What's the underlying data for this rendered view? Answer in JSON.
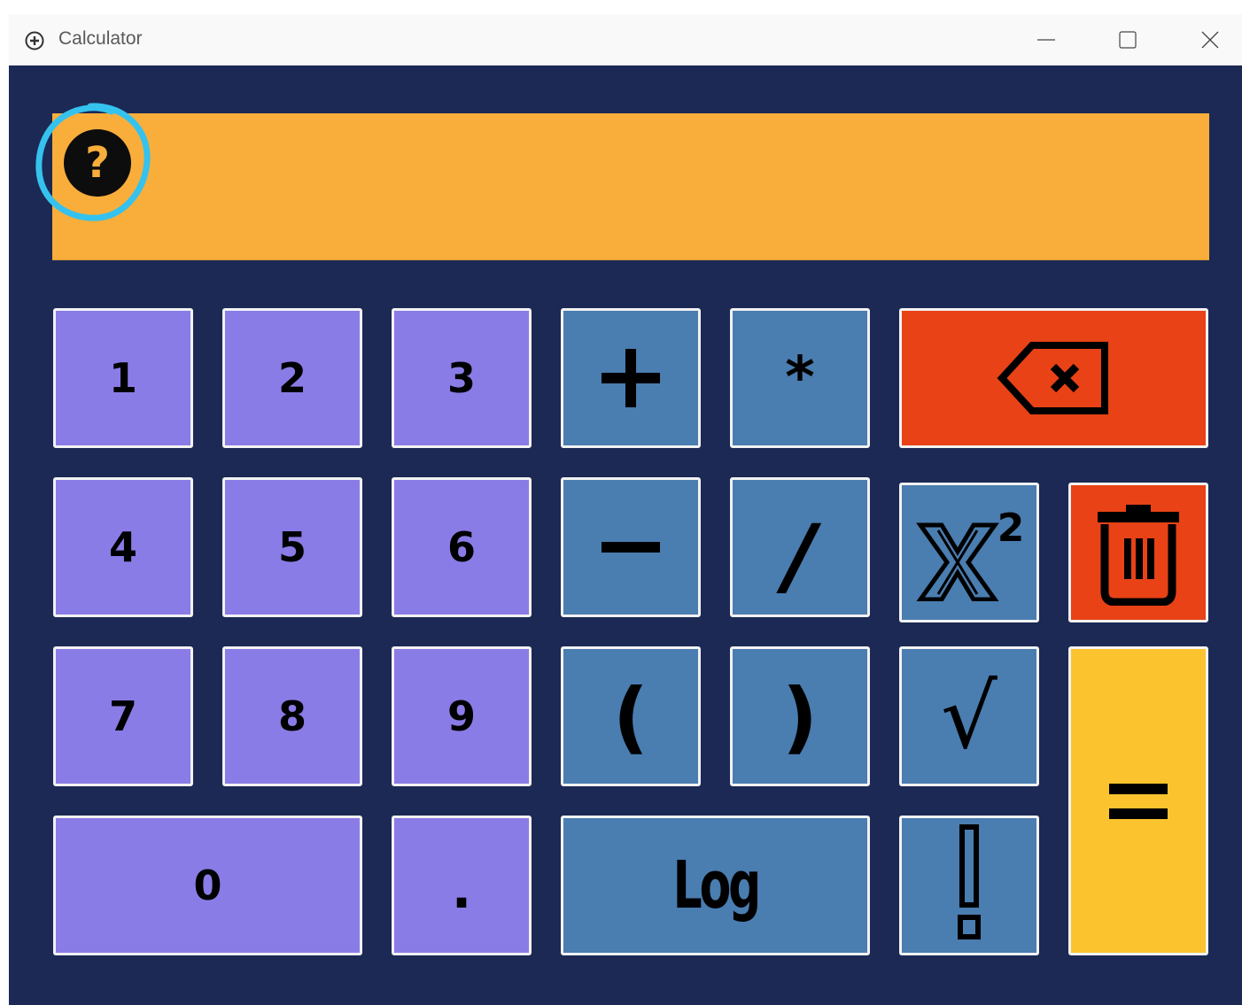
{
  "window": {
    "title": "Calculator"
  },
  "display": {
    "value": ""
  },
  "buttons": {
    "one": "1",
    "two": "2",
    "three": "3",
    "four": "4",
    "five": "5",
    "six": "6",
    "seven": "7",
    "eight": "8",
    "nine": "9",
    "zero": "0",
    "dot": ".",
    "plus_icon": "plus-icon",
    "multiply": "*",
    "minus_icon": "minus-icon",
    "divide": "/",
    "open_paren": "(",
    "close_paren": ")",
    "log": "Log",
    "backspace_icon": "backspace-icon",
    "square_icon": "x-squared-icon",
    "clear_icon": "trash-icon",
    "sqrt": "√",
    "factorial": "!",
    "equals_icon": "equals-icon"
  },
  "colors": {
    "background": "#1b2954",
    "display": "#f9ae3b",
    "number_key": "#8a7ce6",
    "operator_key": "#4a7db0",
    "delete_key": "#e84216",
    "equals_key": "#fbc42e",
    "help_highlight": "#35c2ee"
  }
}
